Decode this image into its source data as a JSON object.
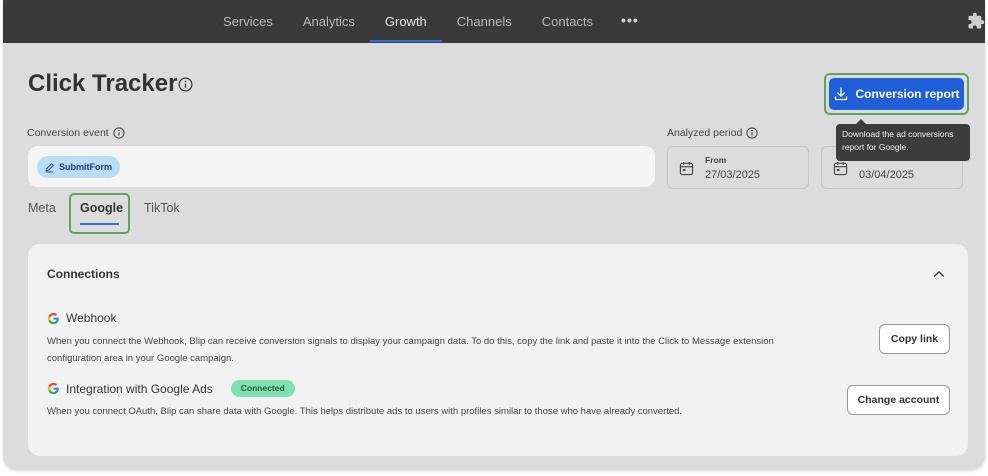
{
  "nav": {
    "items": [
      {
        "label": "Services",
        "active": false
      },
      {
        "label": "Analytics",
        "active": false
      },
      {
        "label": "Growth",
        "active": true
      },
      {
        "label": "Channels",
        "active": false
      },
      {
        "label": "Contacts",
        "active": false
      }
    ],
    "more_icon": "more-dots-icon",
    "extension_icon": "puzzle-icon"
  },
  "page": {
    "title": "Click Tracker",
    "title_icon": "info-icon"
  },
  "conversion_report": {
    "button_label": "Conversion report",
    "icon": "download-icon",
    "tooltip": "Download the ad conversions report for Google."
  },
  "conversion_event": {
    "label": "Conversion event",
    "chip_label": "SubmitForm",
    "chip_icon": "edit-icon"
  },
  "analyzed_period": {
    "label": "Analyzed period",
    "from_label": "From",
    "from_value": "27/03/2025",
    "to_value": "03/04/2025"
  },
  "tabs": {
    "items": [
      "Meta",
      "Google",
      "TikTok"
    ],
    "active": "Google"
  },
  "connections": {
    "title": "Connections",
    "webhook": {
      "title": "Webhook",
      "description": "When you connect the Webhook, Blip can receive conversion signals to display your campaign data. To do this, copy the link and paste it into the Click to Message extension configuration area in your Google campaign.",
      "button": "Copy link"
    },
    "google_ads": {
      "title": "Integration with Google Ads",
      "badge": "Connected",
      "description": "When you connect OAuth, Blip can share data with Google. This helps distribute ads to users with profiles similar to those who have already converted.",
      "button": "Change account"
    }
  },
  "colors": {
    "primary": "#1f5fd8",
    "highlight_border": "#5fa463",
    "badge_bg": "#7fe0b0",
    "topbar": "#3a3a3a"
  }
}
